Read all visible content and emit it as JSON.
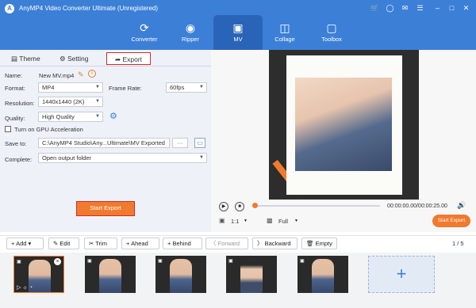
{
  "window": {
    "title": "AnyMP4 Video Converter Ultimate (Unregistered)",
    "logo": "app-logo"
  },
  "nav": {
    "tabs": [
      {
        "label": "Converter",
        "icon": "converter-icon"
      },
      {
        "label": "Ripper",
        "icon": "ripper-icon"
      },
      {
        "label": "MV",
        "icon": "mv-icon",
        "active": true
      },
      {
        "label": "Collage",
        "icon": "collage-icon"
      },
      {
        "label": "Toolbox",
        "icon": "toolbox-icon"
      }
    ]
  },
  "subtabs": {
    "theme": "Theme",
    "setting": "Setting",
    "export": "Export"
  },
  "export": {
    "name_label": "Name:",
    "name_value": "New MV.mp4",
    "format_label": "Format:",
    "format_value": "MP4",
    "framerate_label": "Frame Rate:",
    "framerate_value": "60fps",
    "resolution_label": "Resolution:",
    "resolution_value": "1440x1440 (2K)",
    "quality_label": "Quality:",
    "quality_value": "High Quality",
    "gpu_label": "Turn on GPU Acceleration",
    "gpu_checked": false,
    "saveto_label": "Save to:",
    "saveto_value": "C:\\AnyMP4 Studio\\Any...Ultimate\\MV Exported",
    "browse_label": "···",
    "complete_label": "Complete:",
    "complete_value": "Open output folder",
    "start_label": "Start Export"
  },
  "player": {
    "time": "00:00:00.00/00:00:25.00",
    "ratio": "1:1",
    "view": "Full",
    "start_label": "Start Export",
    "progress": 0
  },
  "toolbar": {
    "add": "Add",
    "edit": "Edit",
    "trim": "Trim",
    "ahead": "Ahead",
    "behind": "Behind",
    "forward": "Forward",
    "backward": "Backward",
    "empty": "Empty",
    "page": "1 / 5"
  },
  "colors": {
    "brand": "#3c7fd6",
    "accent": "#f07a2e",
    "highlight": "#d32a2a"
  }
}
